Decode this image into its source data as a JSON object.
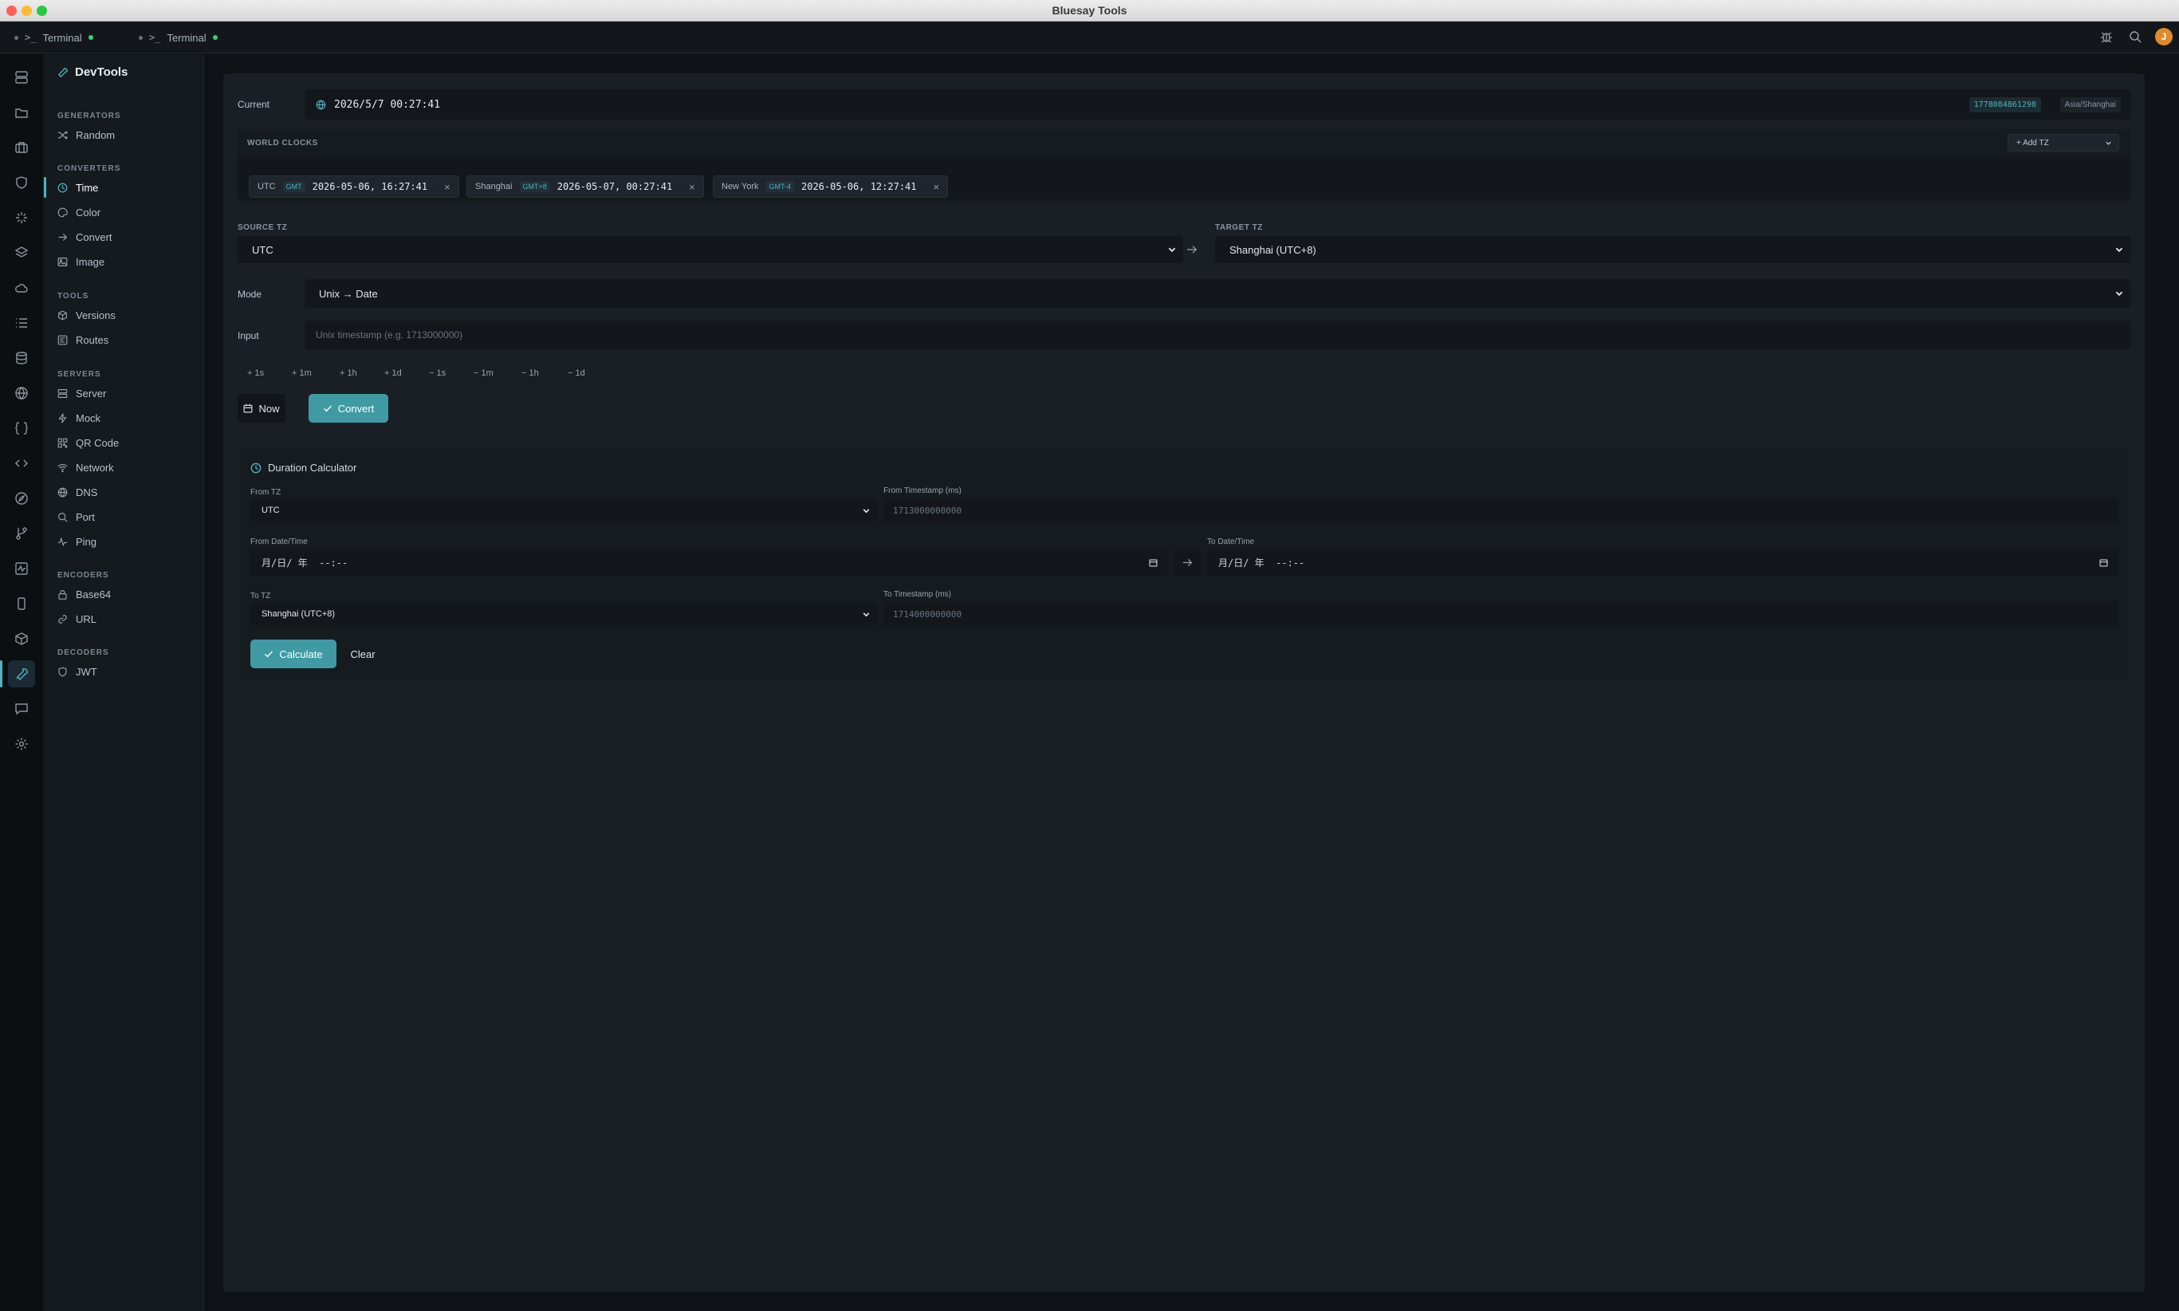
{
  "window": {
    "title": "Bluesay Tools"
  },
  "tabs": [
    {
      "label": "Terminal"
    },
    {
      "label": "Terminal"
    }
  ],
  "sidebar": {
    "title": "DevTools",
    "sections": {
      "generators": "GENERATORS",
      "converters": "CONVERTERS",
      "tools": "TOOLS",
      "servers": "SERVERS",
      "encoders": "ENCODERS",
      "decoders": "DECODERS"
    },
    "items": {
      "random": "Random",
      "time": "Time",
      "color": "Color",
      "convert": "Convert",
      "image": "Image",
      "versions": "Versions",
      "routes": "Routes",
      "server": "Server",
      "mock": "Mock",
      "qrcode": "QR Code",
      "network": "Network",
      "dns": "DNS",
      "port": "Port",
      "ping": "Ping",
      "base64": "Base64",
      "url": "URL",
      "jwt": "JWT"
    },
    "active_item": "Time"
  },
  "current": {
    "label": "Current",
    "datetime": "2026/5/7 00:27:41",
    "timestamp": "1778084861298",
    "zone": "Asia/Shanghai"
  },
  "world_clocks": {
    "label": "WORLD CLOCKS",
    "add_label": "+ Add TZ",
    "clocks": [
      {
        "city": "UTC",
        "offset": "GMT",
        "time": "2026-05-06, 16:27:41"
      },
      {
        "city": "Shanghai",
        "offset": "GMT+8",
        "time": "2026-05-07, 00:27:41"
      },
      {
        "city": "New York",
        "offset": "GMT-4",
        "time": "2026-05-06, 12:27:41"
      }
    ]
  },
  "converter": {
    "source_label": "SOURCE TZ",
    "source_value": "UTC",
    "target_label": "TARGET TZ",
    "target_value": "Shanghai (UTC+8)",
    "mode_label": "Mode",
    "mode_value": "Unix → Date",
    "input_label": "Input",
    "input_placeholder": "Unix timestamp (e.g. 1713000000)",
    "steps": [
      "+ 1s",
      "+ 1m",
      "+ 1h",
      "+ 1d",
      "− 1s",
      "− 1m",
      "− 1h",
      "− 1d"
    ],
    "now_label": "Now",
    "convert_label": "Convert"
  },
  "duration": {
    "title": "Duration Calculator",
    "from_tz_label": "From TZ",
    "from_tz_value": "UTC",
    "from_ts_label": "From Timestamp (ms)",
    "from_ts_placeholder": "1713000000000",
    "from_dt_label": "From Date/Time",
    "from_dt_value": "月/日/ 年  --:--",
    "to_dt_label": "To Date/Time",
    "to_dt_value": "月/日/ 年  --:--",
    "to_tz_label": "To TZ",
    "to_tz_value": "Shanghai (UTC+8)",
    "to_ts_label": "To Timestamp (ms)",
    "to_ts_placeholder": "1714000000000",
    "calculate_label": "Calculate",
    "clear_label": "Clear"
  },
  "colors": {
    "accent": "#4fb3bf",
    "button": "#3f9aa4",
    "background": "#1a1f25"
  }
}
